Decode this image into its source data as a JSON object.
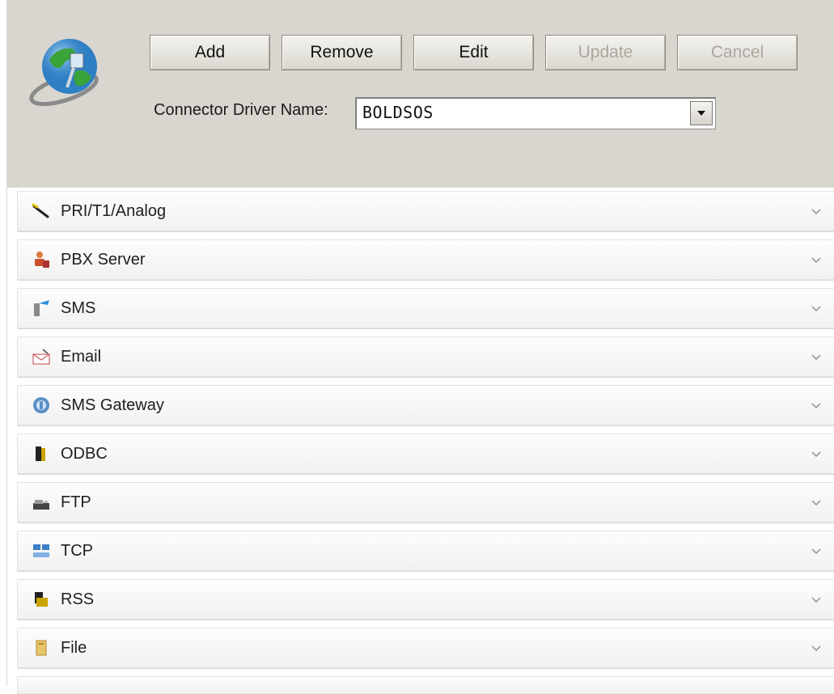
{
  "toolbar": {
    "add_label": "Add",
    "remove_label": "Remove",
    "edit_label": "Edit",
    "update_label": "Update",
    "cancel_label": "Cancel"
  },
  "connector": {
    "label": "Connector Driver Name:",
    "value": "BOLDSOS"
  },
  "panels": [
    {
      "label": "PRI/T1/Analog",
      "icon": "phone-line-icon"
    },
    {
      "label": "PBX Server",
      "icon": "pbx-server-icon"
    },
    {
      "label": "SMS",
      "icon": "sms-icon"
    },
    {
      "label": "Email",
      "icon": "email-icon"
    },
    {
      "label": "SMS Gateway",
      "icon": "sms-gateway-icon"
    },
    {
      "label": "ODBC",
      "icon": "database-icon"
    },
    {
      "label": "FTP",
      "icon": "ftp-icon"
    },
    {
      "label": "TCP",
      "icon": "network-icon"
    },
    {
      "label": "RSS",
      "icon": "rss-icon"
    },
    {
      "label": "File",
      "icon": "file-icon"
    }
  ],
  "colors": {
    "header_bg": "#d9d6cf",
    "disabled_text": "#a9a69f"
  }
}
